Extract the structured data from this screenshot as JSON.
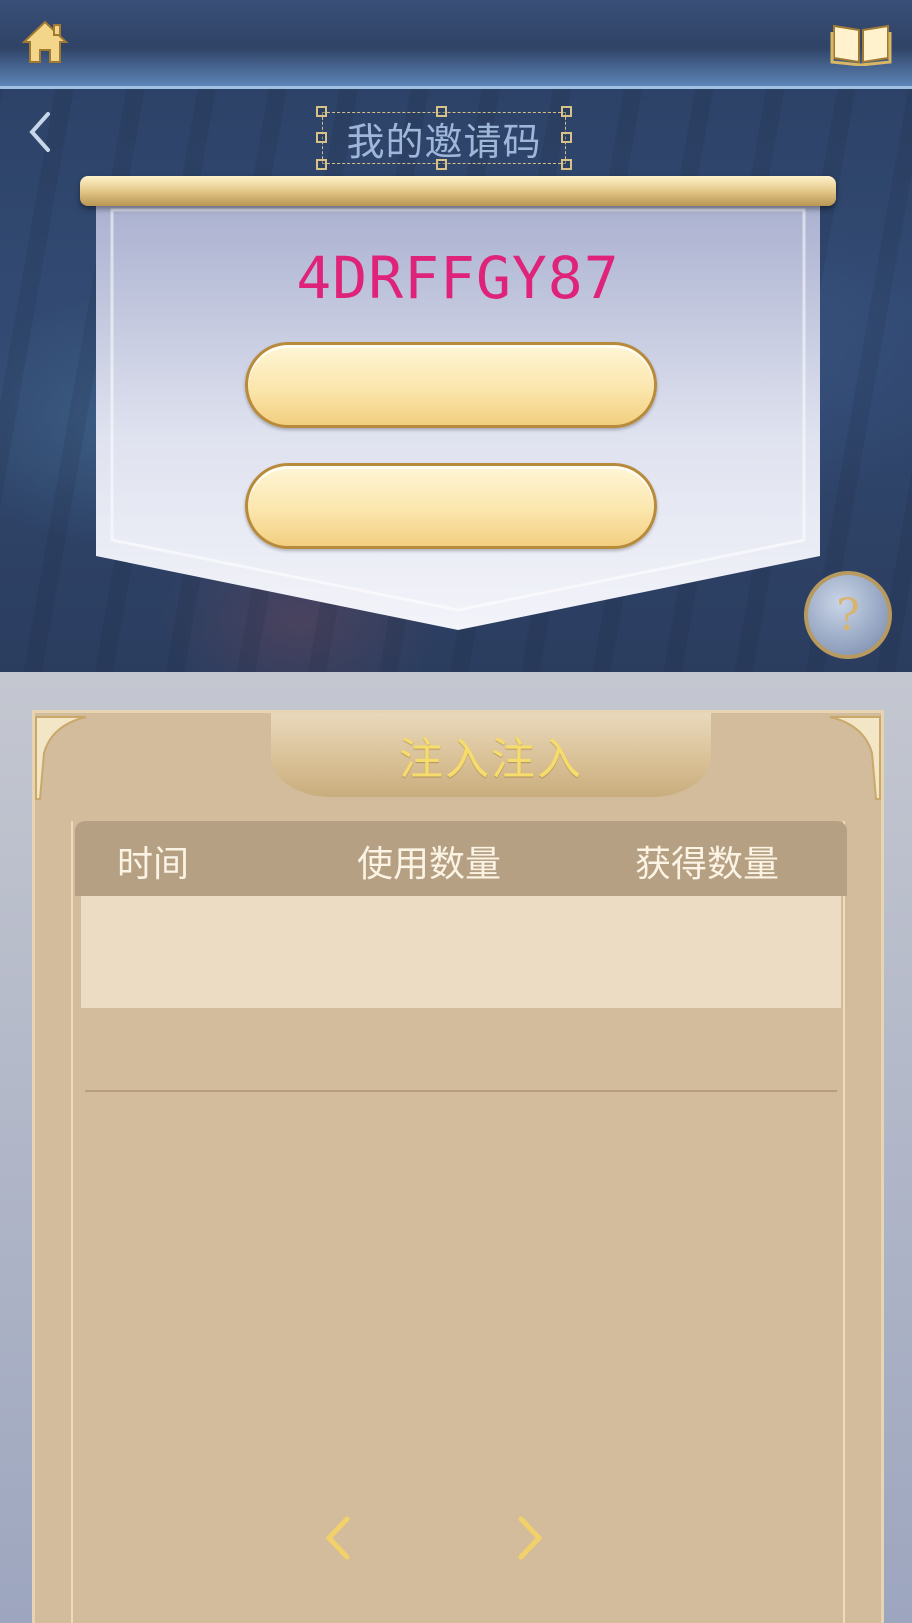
{
  "header": {
    "title": "我的邀请码"
  },
  "invite": {
    "code": "4DRFFGY87",
    "button_1_label": "",
    "button_2_label": ""
  },
  "help": {
    "label": "?"
  },
  "panel": {
    "title": "注入注入",
    "columns": [
      "时间",
      "使用数量",
      "获得数量"
    ],
    "rows": []
  },
  "icons": {
    "home": "home-icon",
    "book": "book-icon",
    "back": "chevron-left-icon",
    "prev": "chevron-left-icon",
    "next": "chevron-right-icon"
  },
  "colors": {
    "invite_code": "#e0237a",
    "panel_title": "#f6dc6a",
    "title": "#9fb8da",
    "gold": "#f2cf80"
  }
}
